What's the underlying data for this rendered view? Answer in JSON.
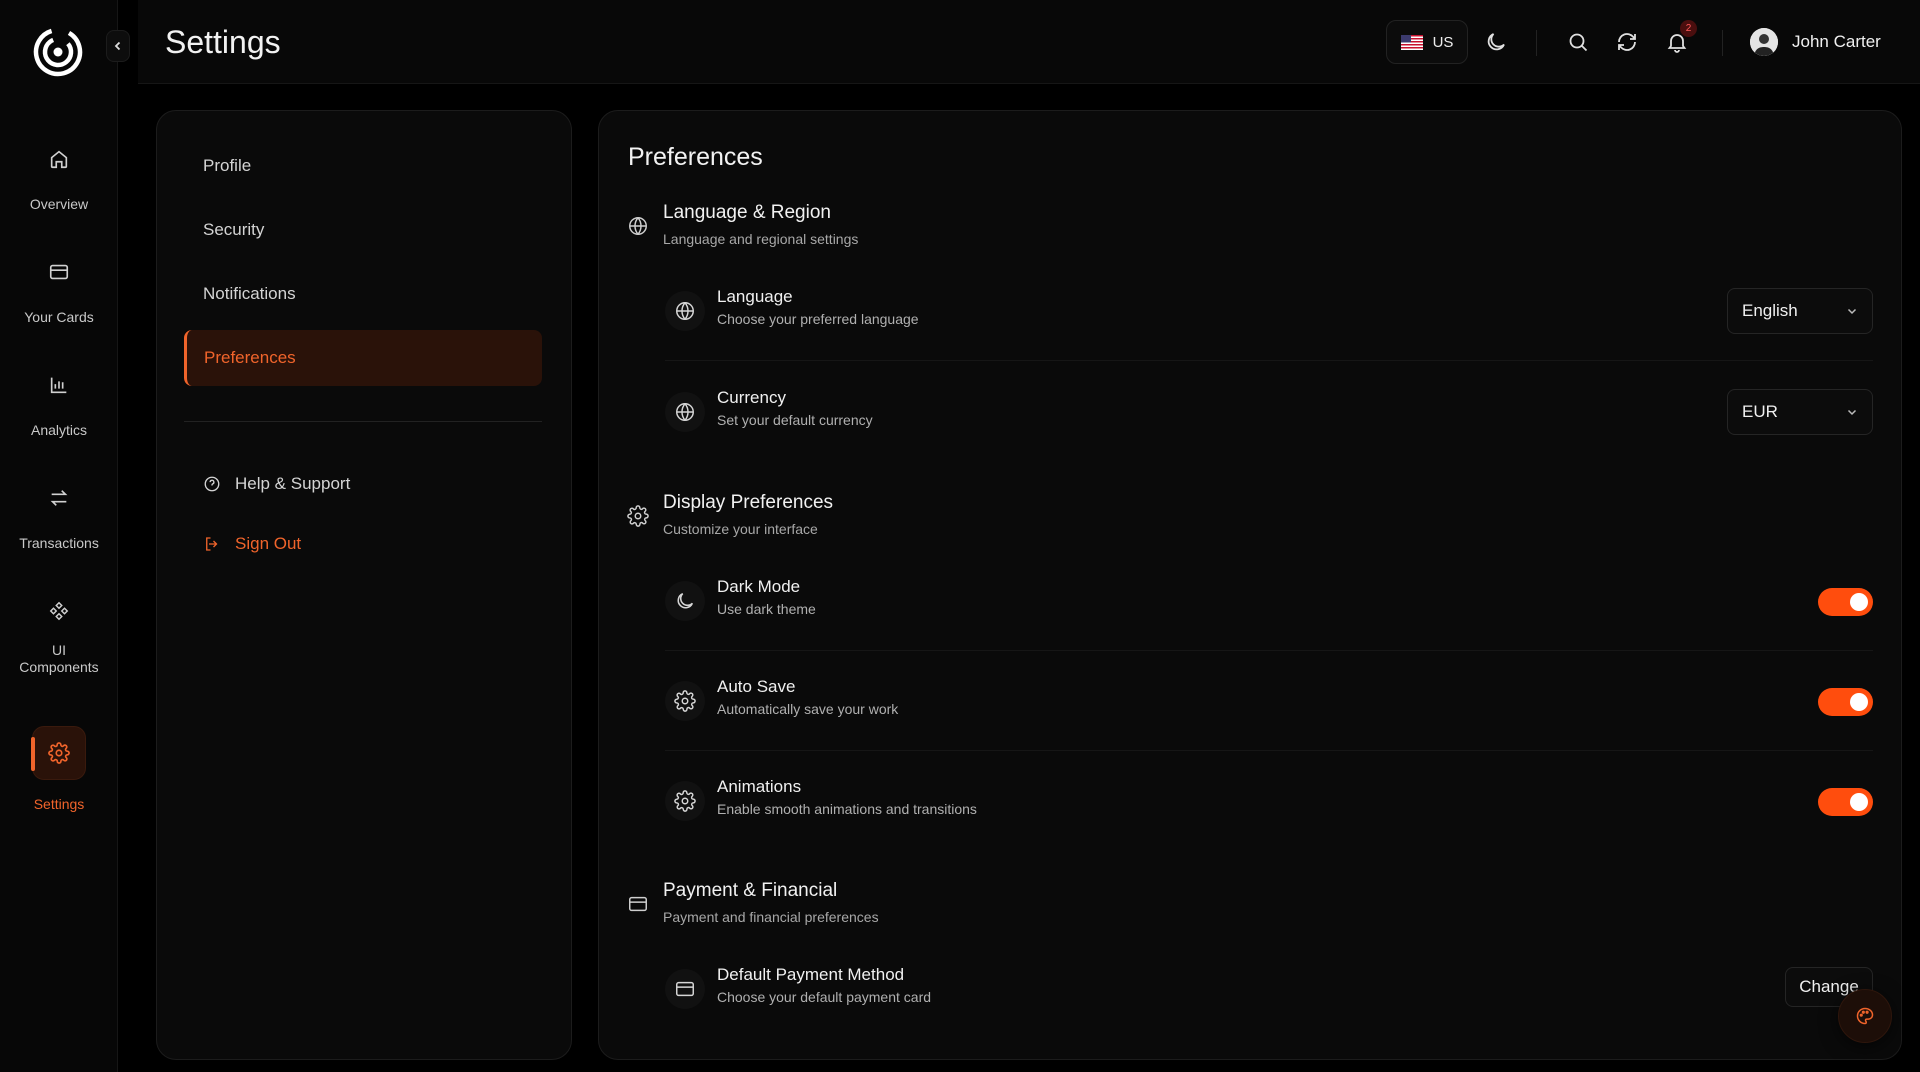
{
  "rail": {
    "items": [
      {
        "label": "Overview",
        "icon": "home-icon"
      },
      {
        "label": "Your Cards",
        "icon": "card-icon"
      },
      {
        "label": "Analytics",
        "icon": "bar-chart-icon"
      },
      {
        "label": "Transactions",
        "icon": "swap-icon"
      },
      {
        "label": "UI Components",
        "icon": "components-icon"
      },
      {
        "label": "Settings",
        "icon": "gear-icon"
      }
    ],
    "active": "Settings"
  },
  "header": {
    "title": "Settings",
    "locale": "US",
    "notifications_count": "2",
    "user_name": "John Carter"
  },
  "menu": {
    "items": [
      "Profile",
      "Security",
      "Notifications",
      "Preferences"
    ],
    "active": "Preferences",
    "help": "Help & Support",
    "signout": "Sign Out"
  },
  "preferences": {
    "title": "Preferences",
    "language_region": {
      "title": "Language & Region",
      "subtitle": "Language and regional settings",
      "language": {
        "title": "Language",
        "subtitle": "Choose your preferred language",
        "value": "English"
      },
      "currency": {
        "title": "Currency",
        "subtitle": "Set your default currency",
        "value": "EUR"
      }
    },
    "display": {
      "title": "Display Preferences",
      "subtitle": "Customize your interface",
      "dark_mode": {
        "title": "Dark Mode",
        "subtitle": "Use dark theme",
        "enabled": true
      },
      "auto_save": {
        "title": "Auto Save",
        "subtitle": "Automatically save your work",
        "enabled": true
      },
      "animations": {
        "title": "Animations",
        "subtitle": "Enable smooth animations and transitions",
        "enabled": true
      }
    },
    "payment": {
      "title": "Payment & Financial",
      "subtitle": "Payment and financial preferences",
      "default_method": {
        "title": "Default Payment Method",
        "subtitle": "Choose your default payment card",
        "button": "Change"
      }
    }
  },
  "colors": {
    "accent": "#f0642b",
    "toggle_on": "#ff4d0d",
    "background": "#000000",
    "panel": "#0a0a0a"
  }
}
